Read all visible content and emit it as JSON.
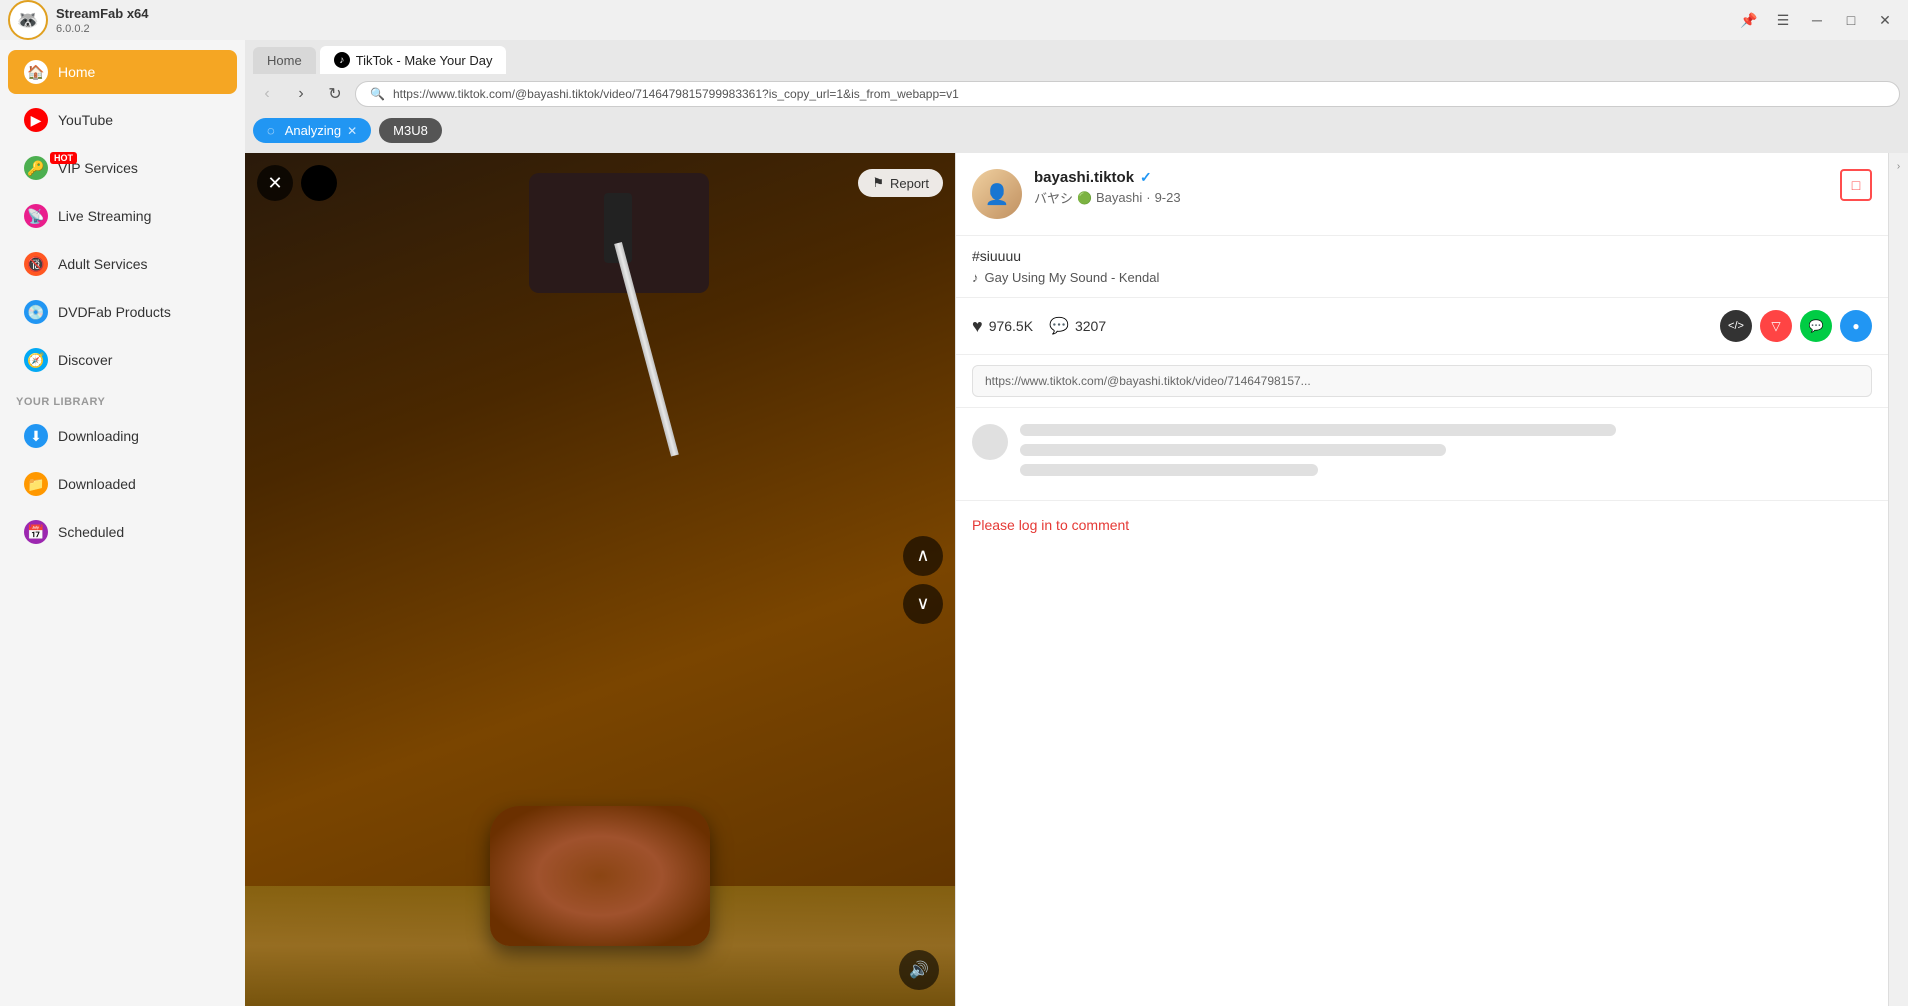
{
  "app": {
    "name": "StreamFab",
    "arch": "x64",
    "version": "6.0.0.2",
    "logo_emoji": "🦝"
  },
  "titlebar": {
    "pin_label": "📌",
    "menu_label": "☰",
    "minimize_label": "─",
    "maximize_label": "□",
    "close_label": "✕"
  },
  "sidebar": {
    "home_label": "Home",
    "youtube_label": "YouTube",
    "vip_label": "VIP Services",
    "live_label": "Live Streaming",
    "adult_label": "Adult Services",
    "dvd_label": "DVDFab Products",
    "discover_label": "Discover",
    "library_header": "YOUR LIBRARY",
    "downloading_label": "Downloading",
    "downloaded_label": "Downloaded",
    "scheduled_label": "Scheduled",
    "hot_badge": "HOT"
  },
  "browser": {
    "home_tab": "Home",
    "active_tab_title": "TikTok - Make Your Day",
    "url": "https://www.tiktok.com/@bayashi.tiktok/video/7146479815799983361?is_copy_url=1&is_from_webapp=v1",
    "url_display": "https://www.tiktok.com/@bayashi.tiktok/video/7146479815799983361?is_copy_url=1&is_from_webapp=v1",
    "analyzing_label": "Analyzing",
    "m3u8_label": "M3U8"
  },
  "video": {
    "report_label": "Report",
    "nav_up": "∧",
    "nav_down": "∨",
    "volume_icon": "🔊"
  },
  "creator": {
    "username": "bayashi.tiktok",
    "display_name": "バヤシ",
    "platform": "Bayashi",
    "date": "9-23",
    "verified": true
  },
  "metadata": {
    "hashtag": "#siuuuu",
    "sound": "Gay Using My Sound - Kendal"
  },
  "engagement": {
    "likes": "976.5K",
    "comments": "3207"
  },
  "share_url": "https://www.tiktok.com/@bayashi.tiktok/video/71464798157...",
  "comments": {
    "login_prompt": "Please log in to comment"
  }
}
